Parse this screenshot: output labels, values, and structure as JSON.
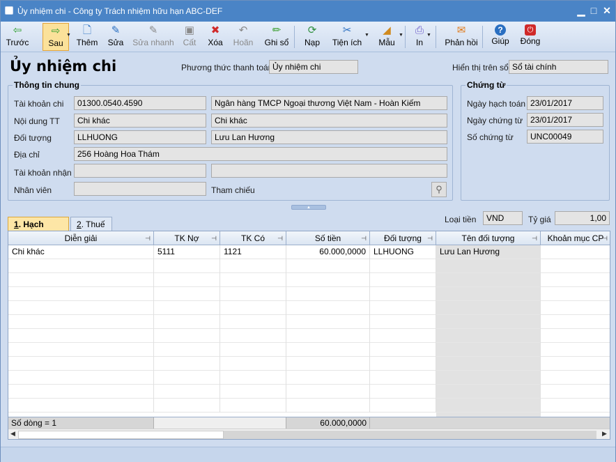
{
  "window": {
    "title": "Ủy nhiệm chi - Công ty Trách nhiệm hữu hạn ABC-DEF",
    "min": "▁",
    "max": "□",
    "close": "✕"
  },
  "toolbar": [
    {
      "id": "back",
      "label": "Trước",
      "icon": "arrow-left-icon",
      "glyph": "⇦",
      "color": "#2e9e2e",
      "dis": false
    },
    {
      "id": "next",
      "label": "Sau",
      "icon": "arrow-right-icon",
      "glyph": "⇨",
      "color": "#2e9e2e",
      "dis": false
    },
    {
      "id": "add",
      "label": "Thêm",
      "icon": "new-doc-icon",
      "glyph": "🗋",
      "color": "#2a6fc1",
      "dis": false
    },
    {
      "id": "edit",
      "label": "Sửa",
      "icon": "edit-icon",
      "glyph": "✎",
      "color": "#2a6fc1",
      "dis": false
    },
    {
      "id": "quickedit",
      "label": "Sửa nhanh",
      "icon": "quick-edit-icon",
      "glyph": "✎",
      "color": "#8a8a8a",
      "dis": true
    },
    {
      "id": "save",
      "label": "Cất",
      "icon": "save-icon",
      "glyph": "▣",
      "color": "#8a8a8a",
      "dis": true
    },
    {
      "id": "delete",
      "label": "Xóa",
      "icon": "delete-icon",
      "glyph": "✖",
      "color": "#d02a2a",
      "dis": false
    },
    {
      "id": "undo",
      "label": "Hoãn",
      "icon": "undo-icon",
      "glyph": "↶",
      "color": "#8a8a8a",
      "dis": true
    },
    {
      "id": "post",
      "label": "Ghi sổ",
      "icon": "post-icon",
      "glyph": "✏",
      "color": "#3a9e2e",
      "dis": false
    },
    {
      "id": "reload",
      "label": "Nạp",
      "icon": "reload-icon",
      "glyph": "⟳",
      "color": "#2e8f3e",
      "dis": false
    },
    {
      "id": "utils",
      "label": "Tiện ích",
      "icon": "tools-icon",
      "glyph": "✂",
      "color": "#2a6fc1",
      "dis": false
    },
    {
      "id": "template",
      "label": "Mẫu",
      "icon": "template-icon",
      "glyph": "◢",
      "color": "#d08a1e",
      "dis": false
    },
    {
      "id": "print",
      "label": "In",
      "icon": "print-icon",
      "glyph": "⎙",
      "color": "#6a5ac9",
      "dis": false
    },
    {
      "id": "feedback",
      "label": "Phản hồi",
      "icon": "mail-icon",
      "glyph": "✉",
      "color": "#e07a1a",
      "dis": false
    },
    {
      "id": "help",
      "label": "Giúp",
      "icon": "help-icon",
      "glyph": "?",
      "color": "#2a6fc1",
      "dis": false
    },
    {
      "id": "close",
      "label": "Đóng",
      "icon": "close-icon",
      "glyph": "⏻",
      "color": "#d02a2a",
      "dis": false
    }
  ],
  "header": {
    "title": "Ủy nhiệm chi",
    "payment_method_label": "Phương thức thanh toán",
    "payment_method": "Ủy nhiệm chi",
    "ledger_label": "Hiển thị trên sổ",
    "ledger": "Sổ tài chính"
  },
  "general": {
    "legend": "Thông tin chung",
    "account_label": "Tài khoản chi",
    "account": "01300.0540.4590",
    "bank": "Ngân hàng TMCP Ngoại thương Việt Nam - Hoàn Kiếm",
    "content_label": "Nội dung TT",
    "content_code": "Chi khác",
    "content_desc": "Chi khác",
    "object_label": "Đối tượng",
    "object_code": "LLHUONG",
    "object_name": "Lưu Lan Hương",
    "address_label": "Địa chỉ",
    "address": "256 Hoàng Hoa Thám",
    "recv_label": "Tài khoản nhận",
    "recv_account": "",
    "recv_bank": "",
    "staff_label": "Nhân viên",
    "staff": "",
    "ref_label": "Tham chiếu"
  },
  "voucher": {
    "legend": "Chứng từ",
    "post_date_label": "Ngày hạch toán",
    "post_date": "23/01/2017",
    "doc_date_label": "Ngày chứng từ",
    "doc_date": "23/01/2017",
    "doc_no_label": "Số chứng từ",
    "doc_no": "UNC00049"
  },
  "tabs": [
    {
      "key": "1",
      "label": ". Hạch toán"
    },
    {
      "key": "2",
      "label": ". Thuế"
    }
  ],
  "currency": {
    "label": "Loại tiền",
    "value": "VND",
    "rate_label": "Tỷ giá",
    "rate": "1,00"
  },
  "table": {
    "columns": [
      "Diễn giải",
      "TK Nợ",
      "TK Có",
      "Số tiền",
      "Đối tượng",
      "Tên đối tượng",
      "Khoản mục CP"
    ],
    "rows": [
      [
        "Chi khác",
        "5111",
        "1121",
        "60.000,0000",
        "LLHUONG",
        "Lưu Lan Hương",
        ""
      ]
    ],
    "footer_count": "Số dòng = 1",
    "footer_total": "60.000,0000"
  }
}
